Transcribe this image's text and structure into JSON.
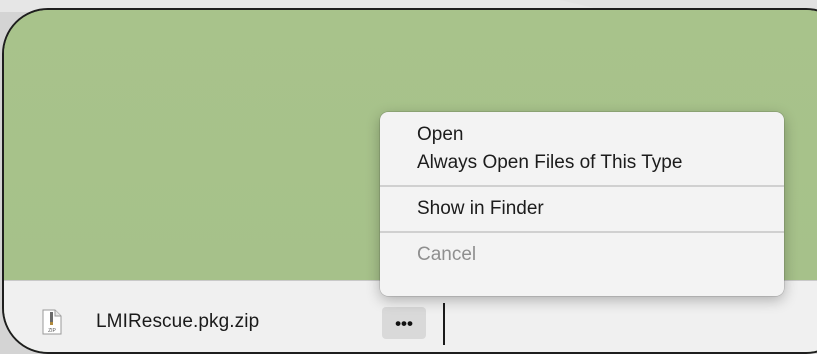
{
  "download": {
    "file_name": "LMIRescue.pkg.zip",
    "file_icon": "zip-file-icon",
    "file_icon_label": "ZIP",
    "more_label": "•••"
  },
  "context_menu": {
    "items": [
      {
        "label": "Open",
        "enabled": true
      },
      {
        "label": "Always Open Files of This Type",
        "enabled": true
      },
      {
        "label": "Show in Finder",
        "enabled": true
      },
      {
        "label": "Cancel",
        "enabled": false
      }
    ]
  },
  "colors": {
    "content_bg": "#a8c38b",
    "bar_bg": "#f0f0f0",
    "menu_bg": "#f3f3f3",
    "outline": "#1e1e1e"
  }
}
